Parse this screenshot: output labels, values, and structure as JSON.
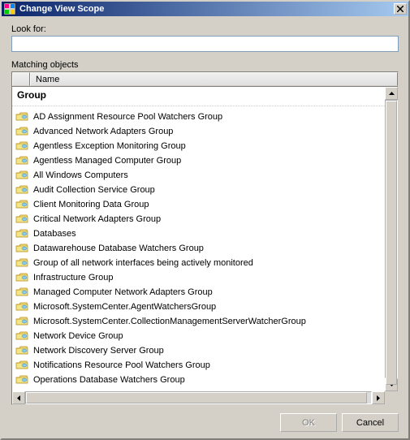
{
  "titlebar": {
    "title": "Change View Scope"
  },
  "labels": {
    "look_for": "Look for:",
    "matching_objects": "Matching objects"
  },
  "input": {
    "lookfor_value": ""
  },
  "columns": {
    "name": "Name"
  },
  "group_header": "Group",
  "items": [
    "AD Assignment Resource Pool Watchers Group",
    "Advanced Network Adapters Group",
    "Agentless Exception Monitoring Group",
    "Agentless Managed Computer Group",
    "All Windows Computers",
    "Audit Collection Service Group",
    "Client Monitoring Data Group",
    "Critical Network Adapters Group",
    "Databases",
    "Datawarehouse Database Watchers Group",
    "Group of all network interfaces being actively monitored",
    "Infrastructure Group",
    "Managed Computer Network Adapters Group",
    "Microsoft.SystemCenter.AgentWatchersGroup",
    "Microsoft.SystemCenter.CollectionManagementServerWatcherGroup",
    "Network Device Group",
    "Network Discovery Server Group",
    "Notifications Resource Pool Watchers Group",
    "Operations Database Watchers Group"
  ],
  "buttons": {
    "ok": "OK",
    "cancel": "Cancel"
  },
  "icon_name": "folder-group-icon"
}
